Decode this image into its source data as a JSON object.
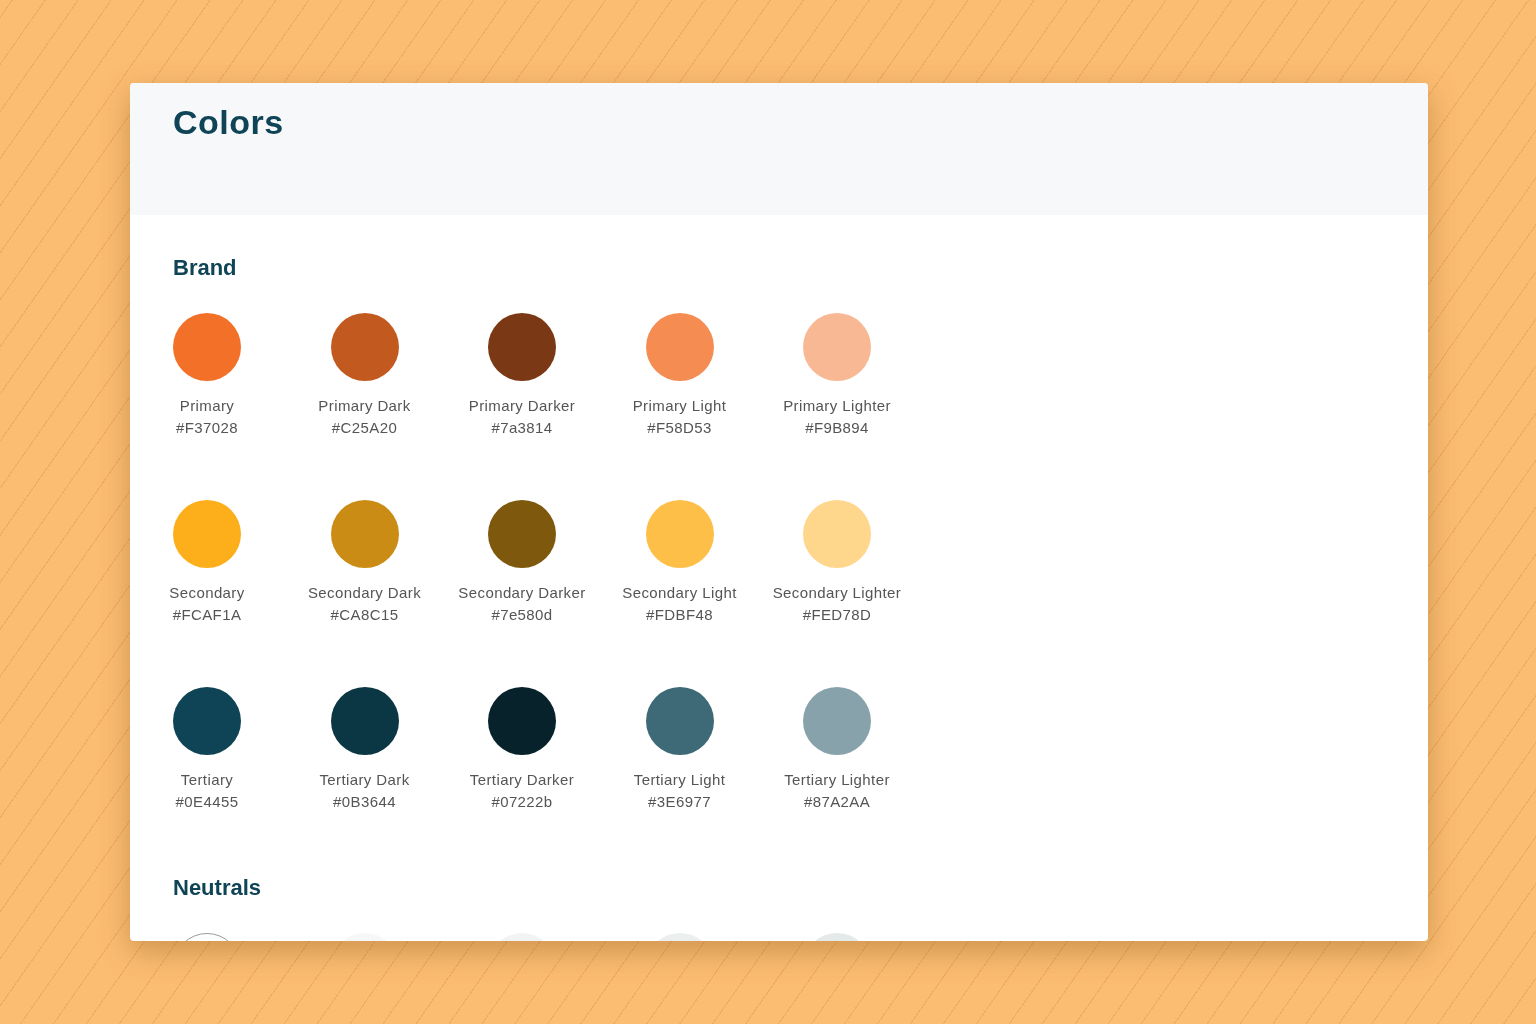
{
  "title": "Colors",
  "sections": [
    {
      "heading": "Brand",
      "swatches": [
        {
          "name": "Primary",
          "hex": "#F37028",
          "color": "#f37028"
        },
        {
          "name": "Primary Dark",
          "hex": "#C25A20",
          "color": "#c25a20"
        },
        {
          "name": "Primary Darker",
          "hex": "#7a3814",
          "color": "#7a3814"
        },
        {
          "name": "Primary Light",
          "hex": "#F58D53",
          "color": "#f58d53"
        },
        {
          "name": "Primary Lighter",
          "hex": "#F9B894",
          "color": "#f9b894"
        },
        {
          "name": "Secondary",
          "hex": "#FCAF1A",
          "color": "#fcaf1a"
        },
        {
          "name": "Secondary Dark",
          "hex": "#CA8C15",
          "color": "#ca8c15"
        },
        {
          "name": "Secondary Darker",
          "hex": "#7e580d",
          "color": "#7e580d"
        },
        {
          "name": "Secondary Light",
          "hex": "#FDBF48",
          "color": "#fdbf48"
        },
        {
          "name": "Secondary Lighter",
          "hex": "#FED78D",
          "color": "#fed78d"
        },
        {
          "name": "Tertiary",
          "hex": "#0E4455",
          "color": "#0e4455"
        },
        {
          "name": "Tertiary Dark",
          "hex": "#0B3644",
          "color": "#0b3644"
        },
        {
          "name": "Tertiary Darker",
          "hex": "#07222b",
          "color": "#07222b"
        },
        {
          "name": "Tertiary Light",
          "hex": "#3E6977",
          "color": "#3e6977"
        },
        {
          "name": "Tertiary Lighter",
          "hex": "#87A2AA",
          "color": "#87a2aa"
        }
      ]
    },
    {
      "heading": "Neutrals",
      "swatches": [
        {
          "color": "#ffffff"
        },
        {
          "color": "#f6f7f8"
        },
        {
          "color": "#f1f3f4"
        },
        {
          "color": "#eceff0"
        },
        {
          "color": "#e4e9ea"
        }
      ]
    }
  ]
}
